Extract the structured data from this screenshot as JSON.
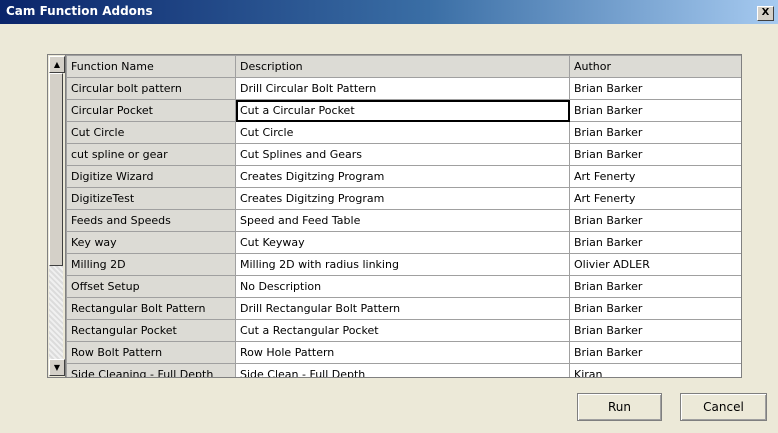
{
  "window": {
    "title": "Cam Function Addons",
    "close_label": "X"
  },
  "grid": {
    "headers": {
      "name": "Function Name",
      "description": "Description",
      "author": "Author"
    },
    "rows": [
      {
        "name": "Circular bolt pattern",
        "description": "Drill Circular Bolt Pattern",
        "author": "Brian Barker"
      },
      {
        "name": "Circular Pocket",
        "description": "Cut a Circular Pocket",
        "author": "Brian Barker"
      },
      {
        "name": "Cut Circle",
        "description": "Cut Circle",
        "author": "Brian Barker"
      },
      {
        "name": "cut spline or gear",
        "description": "Cut Splines and Gears",
        "author": "Brian Barker"
      },
      {
        "name": "Digitize Wizard",
        "description": "Creates Digitzing Program",
        "author": "Art Fenerty"
      },
      {
        "name": "DigitizeTest",
        "description": "Creates Digitzing Program",
        "author": "Art Fenerty"
      },
      {
        "name": "Feeds and Speeds",
        "description": "Speed and Feed Table",
        "author": "Brian Barker"
      },
      {
        "name": "Key way",
        "description": "Cut Keyway",
        "author": "Brian Barker"
      },
      {
        "name": "Milling 2D",
        "description": "Milling 2D with radius linking",
        "author": "Olivier ADLER"
      },
      {
        "name": "Offset Setup",
        "description": "No Description",
        "author": "Brian Barker"
      },
      {
        "name": "Rectangular Bolt Pattern",
        "description": "Drill Rectangular Bolt Pattern",
        "author": "Brian Barker"
      },
      {
        "name": "Rectangular Pocket",
        "description": "Cut a Rectangular Pocket",
        "author": "Brian Barker"
      },
      {
        "name": "Row Bolt Pattern",
        "description": "Row Hole Pattern",
        "author": "Brian Barker"
      },
      {
        "name": "Side Cleaning - Full Depth",
        "description": "Side Clean - Full Depth",
        "author": "Kiran"
      }
    ]
  },
  "buttons": {
    "run": "Run",
    "cancel": "Cancel"
  }
}
